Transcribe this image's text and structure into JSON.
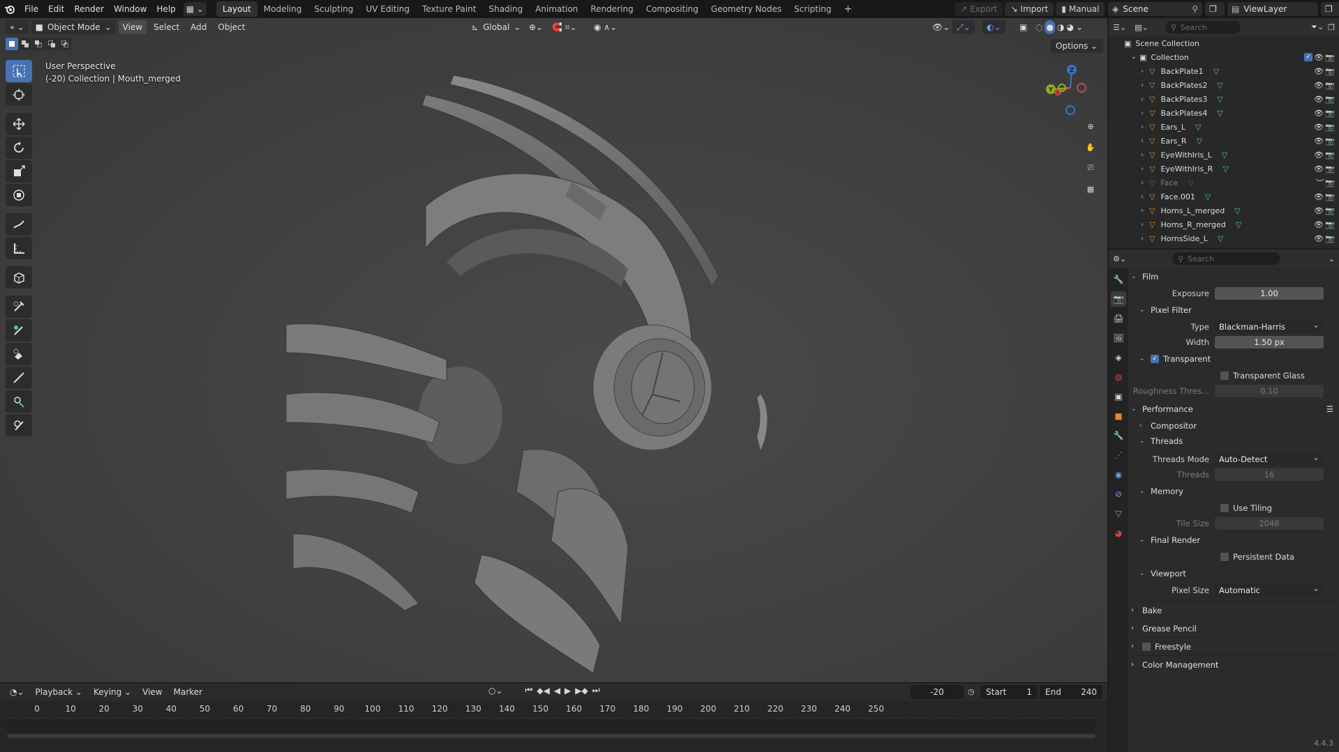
{
  "topbar": {
    "menus": [
      "File",
      "Edit",
      "Render",
      "Window",
      "Help"
    ],
    "workspaces": [
      "Layout",
      "Modeling",
      "Sculpting",
      "UV Editing",
      "Texture Paint",
      "Shading",
      "Animation",
      "Rendering",
      "Compositing",
      "Geometry Nodes",
      "Scripting"
    ],
    "active_workspace": "Layout",
    "export_label": "Export",
    "import_label": "Import",
    "manual_label": "Manual",
    "scene": "Scene",
    "view_layer": "ViewLayer"
  },
  "viewport": {
    "mode": "Object Mode",
    "menus": [
      "View",
      "Select",
      "Add",
      "Object"
    ],
    "orientation": "Global",
    "options_label": "Options",
    "info_line1": "User Perspective",
    "info_line2": "(-20) Collection | Mouth_merged"
  },
  "timeline": {
    "menus": [
      "Playback",
      "Keying",
      "View",
      "Marker"
    ],
    "current_frame": "-20",
    "start_label": "Start",
    "start": "1",
    "end_label": "End",
    "end": "240",
    "ticks": [
      "0",
      "10",
      "20",
      "30",
      "40",
      "50",
      "60",
      "70",
      "80",
      "90",
      "100",
      "110",
      "120",
      "130",
      "140",
      "150",
      "160",
      "170",
      "180",
      "190",
      "200",
      "210",
      "220",
      "230",
      "240",
      "250"
    ]
  },
  "outliner": {
    "search_placeholder": "Search",
    "scene_collection": "Scene Collection",
    "collection": "Collection",
    "items": [
      {
        "name": "BackPlate1",
        "dim": false
      },
      {
        "name": "BackPlates2",
        "dim": false
      },
      {
        "name": "BackPlates3",
        "dim": false
      },
      {
        "name": "BackPlates4",
        "dim": false
      },
      {
        "name": "Ears_L",
        "dim": false
      },
      {
        "name": "Ears_R",
        "dim": false
      },
      {
        "name": "EyeWithIris_L",
        "dim": false
      },
      {
        "name": "EyeWithIris_R",
        "dim": false
      },
      {
        "name": "Face",
        "dim": true
      },
      {
        "name": "Face.001",
        "dim": false
      },
      {
        "name": "Horns_L_merged",
        "dim": false
      },
      {
        "name": "Horns_R_merged",
        "dim": false
      },
      {
        "name": "HornsSide_L",
        "dim": false
      }
    ]
  },
  "properties": {
    "search_placeholder": "Search",
    "film": "Film",
    "exposure_label": "Exposure",
    "exposure": "1.00",
    "pixel_filter": "Pixel Filter",
    "type_label": "Type",
    "type": "Blackman-Harris",
    "width_label": "Width",
    "width": "1.50 px",
    "transparent": "Transparent",
    "transparent_glass": "Transparent Glass",
    "roughness_label": "Roughness Thres...",
    "roughness": "0.10",
    "performance": "Performance",
    "compositor": "Compositor",
    "threads": "Threads",
    "threads_mode_label": "Threads Mode",
    "threads_mode": "Auto-Detect",
    "threads_label": "Threads",
    "threads_value": "16",
    "memory": "Memory",
    "use_tiling": "Use Tiling",
    "tile_size_label": "Tile Size",
    "tile_size": "2048",
    "final_render": "Final Render",
    "persistent_data": "Persistent Data",
    "viewport": "Viewport",
    "pixel_size_label": "Pixel Size",
    "pixel_size": "Automatic",
    "bake": "Bake",
    "grease_pencil": "Grease Pencil",
    "freestyle": "Freestyle",
    "color_management": "Color Management",
    "version": "4.4.3"
  },
  "colors": {
    "accent": "#4772b3",
    "object_orange": "#e8892a",
    "mesh_green": "#4ec79a"
  }
}
